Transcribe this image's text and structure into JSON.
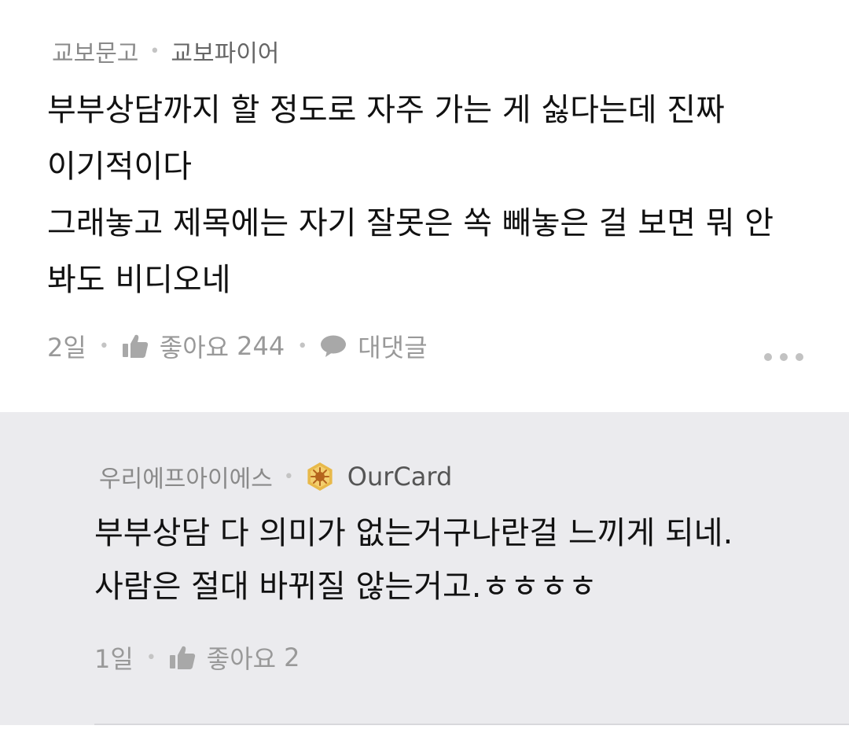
{
  "comment": {
    "username": "교보문고",
    "nickname": "교보파이어",
    "lines": [
      "부부상담까지 할 정도로 자주 가는 게 싫다는데 진짜",
      "이기적이다",
      "그래놓고 제목에는 자기 잘못은 쏙 빼놓은 걸 보면 뭐 안",
      "봐도 비디오네"
    ],
    "time": "2일",
    "like_label": "좋아요",
    "like_count": "244",
    "reply_label": "대댓글",
    "icons": {
      "like": "thumbs-up-icon",
      "reply": "speech-bubble-icon",
      "more": "more-dots-icon"
    }
  },
  "reply": {
    "username": "우리에프아이에스",
    "nickname": "OurCard",
    "lines": [
      "부부상담 다 의미가 없는거구나란걸 느끼게 되네.",
      "사람은 절대 바뀌질 않는거고.ㅎㅎㅎㅎ"
    ],
    "time": "1일",
    "like_label": "좋아요",
    "like_count": "2",
    "icons": {
      "badge": "gold-badge-icon",
      "like": "thumbs-up-icon"
    }
  },
  "colors": {
    "reply_background": "#ebebee",
    "badge_gold": "#e8b94a"
  }
}
